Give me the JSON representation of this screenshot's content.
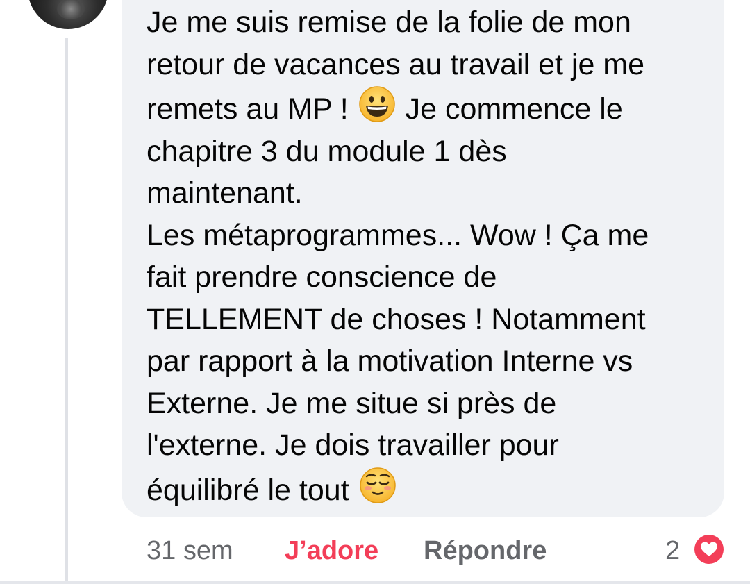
{
  "comment": {
    "text_part1": "Je me suis remise de la folie de mon\nretour de vacances au travail et je me\nremets au MP !",
    "text_part2": "Je commence le\nchapitre 3 du module 1 dès\nmaintenant.\nLes métaprogrammes... Wow ! Ça me\nfait prendre conscience de\nTELLEMENT de choses ! Notamment\npar rapport à la motivation Interne vs\nExterne. Je me situe si près de\nl'externe. Je dois travailler pour\néquilibré le tout",
    "emoji_1": "grinning-face-emoji",
    "emoji_2": "relieved-face-emoji"
  },
  "actions": {
    "time": "31 sem",
    "reaction_label": "J’adore",
    "reply_label": "Répondre"
  },
  "reactions": {
    "count": "2",
    "icon": "heart-icon",
    "color": "#f33e58"
  },
  "colors": {
    "bubble": "#f0f2f5",
    "secondary_text": "#65676b",
    "love": "#f33e58"
  }
}
